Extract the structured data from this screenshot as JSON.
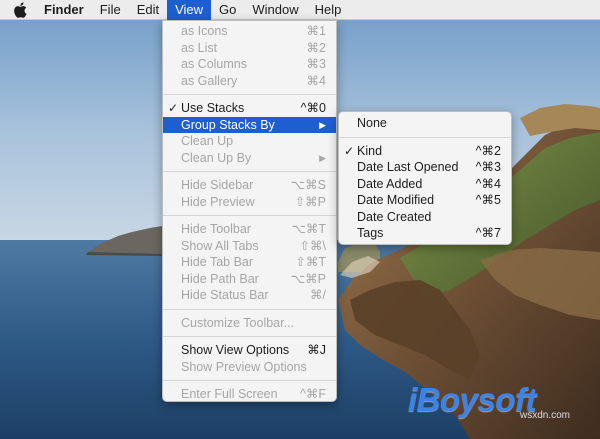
{
  "menubar": {
    "app_name": "Finder",
    "items": [
      "File",
      "Edit",
      "View",
      "Go",
      "Window",
      "Help"
    ],
    "active_item": "View"
  },
  "view_menu": {
    "groups": [
      [
        {
          "label": "as Icons",
          "shortcut": "⌘1",
          "enabled": false
        },
        {
          "label": "as List",
          "shortcut": "⌘2",
          "enabled": false
        },
        {
          "label": "as Columns",
          "shortcut": "⌘3",
          "enabled": false
        },
        {
          "label": "as Gallery",
          "shortcut": "⌘4",
          "enabled": false
        }
      ],
      [
        {
          "label": "Use Stacks",
          "shortcut": "^⌘0",
          "enabled": true,
          "checked": true
        },
        {
          "label": "Group Stacks By",
          "shortcut": "▶",
          "enabled": true,
          "highlighted": true,
          "submenu": true
        },
        {
          "label": "Clean Up",
          "shortcut": "",
          "enabled": false
        },
        {
          "label": "Clean Up By",
          "shortcut": "▶",
          "enabled": false,
          "submenu": true
        }
      ],
      [
        {
          "label": "Hide Sidebar",
          "shortcut": "⌥⌘S",
          "enabled": false
        },
        {
          "label": "Hide Preview",
          "shortcut": "⇧⌘P",
          "enabled": false
        }
      ],
      [
        {
          "label": "Hide Toolbar",
          "shortcut": "⌥⌘T",
          "enabled": false
        },
        {
          "label": "Show All Tabs",
          "shortcut": "⇧⌘\\",
          "enabled": false
        },
        {
          "label": "Hide Tab Bar",
          "shortcut": "⇧⌘T",
          "enabled": false
        },
        {
          "label": "Hide Path Bar",
          "shortcut": "⌥⌘P",
          "enabled": false
        },
        {
          "label": "Hide Status Bar",
          "shortcut": "⌘/",
          "enabled": false
        }
      ],
      [
        {
          "label": "Customize Toolbar...",
          "shortcut": "",
          "enabled": false
        }
      ],
      [
        {
          "label": "Show View Options",
          "shortcut": "⌘J",
          "enabled": true
        },
        {
          "label": "Show Preview Options",
          "shortcut": "",
          "enabled": false
        }
      ],
      [
        {
          "label": "Enter Full Screen",
          "shortcut": "^⌘F",
          "enabled": false
        }
      ]
    ]
  },
  "group_by_submenu": {
    "groups": [
      [
        {
          "label": "None",
          "shortcut": ""
        }
      ],
      [
        {
          "label": "Kind",
          "shortcut": "^⌘2",
          "checked": true
        },
        {
          "label": "Date Last Opened",
          "shortcut": "^⌘3"
        },
        {
          "label": "Date Added",
          "shortcut": "^⌘4"
        },
        {
          "label": "Date Modified",
          "shortcut": "^⌘5"
        },
        {
          "label": "Date Created",
          "shortcut": ""
        },
        {
          "label": "Tags",
          "shortcut": "^⌘7"
        }
      ]
    ]
  },
  "watermark": {
    "logo_text": "iBoysoft",
    "site_text": "wsxdn.com"
  },
  "colors": {
    "menubar_bg": "#ececec",
    "menu_bg": "#f4f4f4",
    "highlight": "#1d5fd1",
    "disabled_text": "#a6a6a6",
    "sky": "#8fb2d3",
    "sea": "#2d5a86",
    "watermark_blue": "#3b83e8"
  },
  "icons": {
    "apple_menu": "apple-icon",
    "checkmark": "checkmark-icon",
    "submenu_arrow": "chevron-right-icon"
  }
}
